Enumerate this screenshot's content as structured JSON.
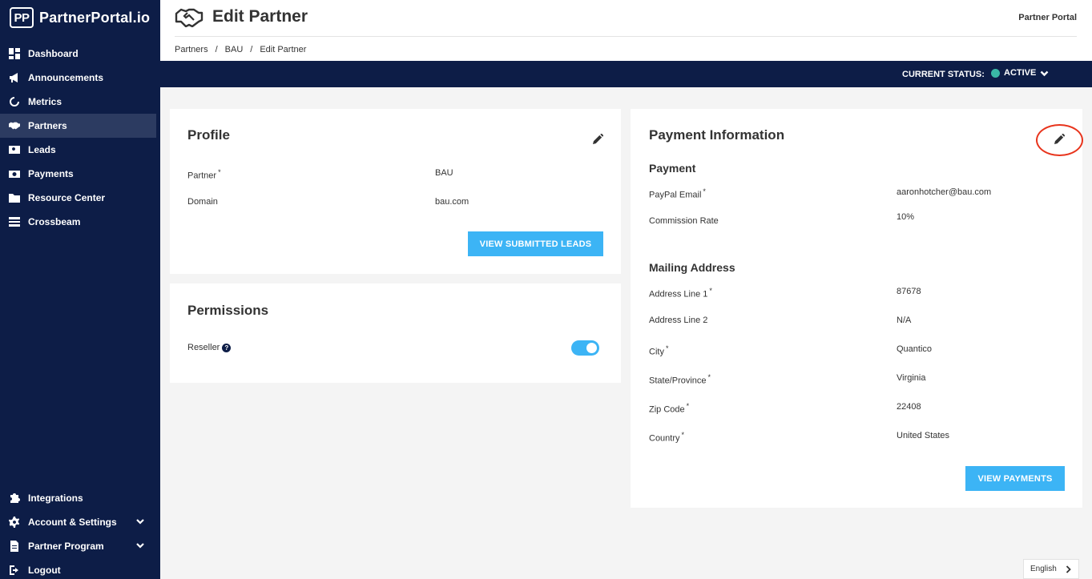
{
  "app": {
    "name": "PartnerPortal.io",
    "logo_mark": "PP"
  },
  "sidebar": {
    "items": [
      {
        "label": "Dashboard",
        "icon": "dashboard-icon"
      },
      {
        "label": "Announcements",
        "icon": "megaphone-icon"
      },
      {
        "label": "Metrics",
        "icon": "metrics-icon"
      },
      {
        "label": "Partners",
        "icon": "handshake-icon",
        "active": true
      },
      {
        "label": "Leads",
        "icon": "leads-icon"
      },
      {
        "label": "Payments",
        "icon": "payments-icon"
      },
      {
        "label": "Resource Center",
        "icon": "folder-icon"
      },
      {
        "label": "Crossbeam",
        "icon": "crossbeam-icon"
      }
    ],
    "bottom_items": [
      {
        "label": "Integrations",
        "icon": "puzzle-icon"
      },
      {
        "label": "Account & Settings",
        "icon": "gear-icon"
      },
      {
        "label": "Partner Program",
        "icon": "document-icon"
      },
      {
        "label": "Logout",
        "icon": "logout-icon"
      }
    ]
  },
  "header": {
    "title": "Edit Partner",
    "portal_label": "Partner Portal",
    "breadcrumb": [
      "Partners",
      "BAU",
      "Edit Partner"
    ],
    "breadcrumb_sep": "/"
  },
  "status": {
    "label": "CURRENT STATUS:",
    "value": "ACTIVE",
    "color": "#3ab9a6"
  },
  "profile": {
    "title": "Profile",
    "fields": [
      {
        "label": "Partner",
        "required": "*",
        "value": "BAU"
      },
      {
        "label": "Domain",
        "value": "bau.com"
      }
    ],
    "button": "VIEW SUBMITTED LEADS"
  },
  "permissions": {
    "title": "Permissions",
    "reseller_label": "Reseller",
    "help_glyph": "?",
    "reseller_enabled": true
  },
  "payment": {
    "title": "Payment Information",
    "payment_section": "Payment",
    "payment_fields": [
      {
        "label": "PayPal Email",
        "required": "*",
        "value": "aaronhotcher@bau.com"
      },
      {
        "label": "Commission Rate",
        "value": "10%"
      }
    ],
    "address_section": "Mailing Address",
    "address_fields": [
      {
        "label": "Address Line 1",
        "required": "*",
        "value": "87678"
      },
      {
        "label": "Address Line 2",
        "value": "N/A"
      },
      {
        "label": "City",
        "required": "*",
        "value": "Quantico"
      },
      {
        "label": "State/Province",
        "required": "*",
        "value": "Virginia"
      },
      {
        "label": "Zip Code",
        "required": "*",
        "value": "22408"
      },
      {
        "label": "Country",
        "required": "*",
        "value": "United States"
      }
    ],
    "button": "VIEW PAYMENTS"
  },
  "language": {
    "value": "English"
  },
  "colors": {
    "sidebar": "#0d1d47",
    "accent": "#3cb4f5",
    "annotation": "#e8341c"
  }
}
